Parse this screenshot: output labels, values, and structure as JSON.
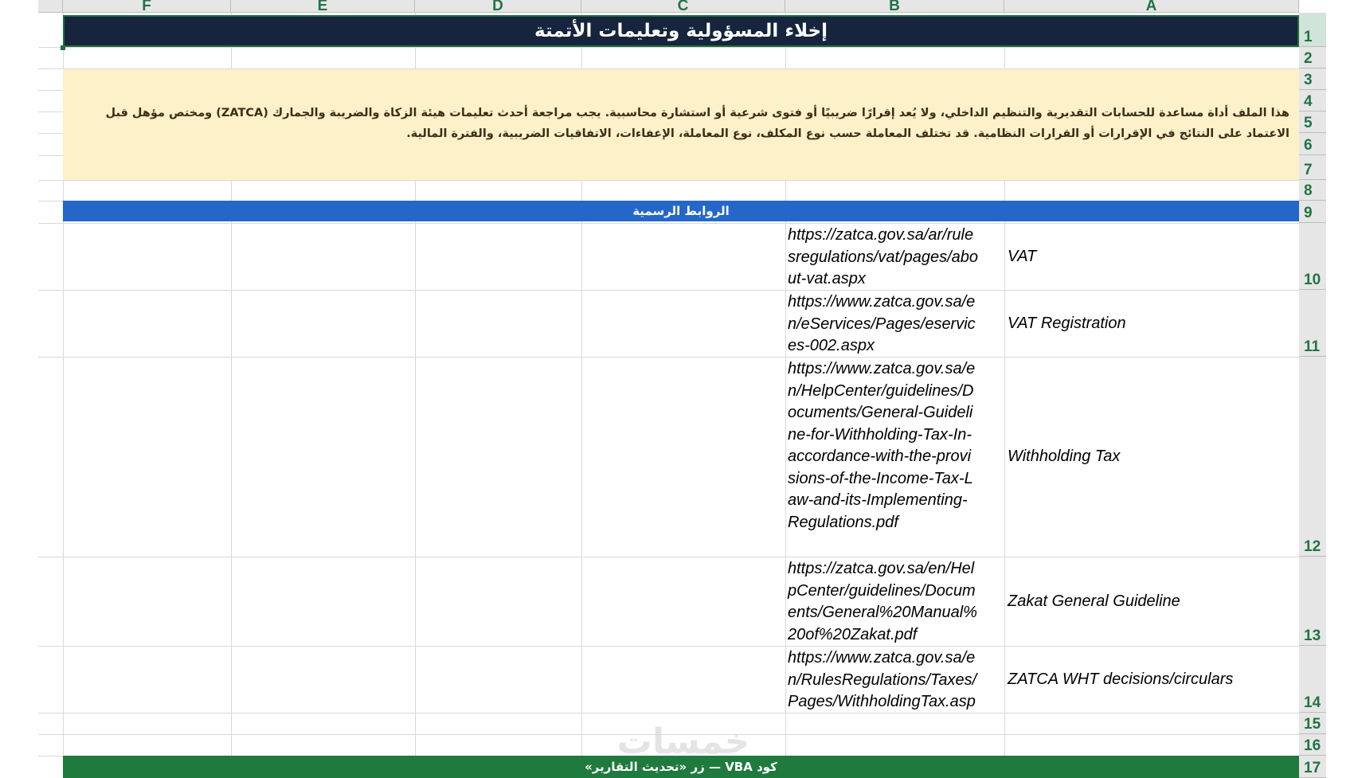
{
  "columns": [
    "F",
    "E",
    "D",
    "C",
    "B",
    "A"
  ],
  "rows": [
    "1",
    "2",
    "3",
    "4",
    "5",
    "6",
    "7",
    "8",
    "9",
    "10",
    "11",
    "12",
    "13",
    "14",
    "15",
    "16",
    "17"
  ],
  "title": "إخلاء المسؤولية وتعليمات الأتمتة",
  "disclaimer": "هذا الملف أداة مساعدة للحسابات التقديرية والتنظيم الداخلي، ولا يُعد إقرارًا ضريبيًا أو فتوى شرعية أو استشارة محاسبية. يجب مراجعة أحدث تعليمات هيئة الزكاة والضريبة والجمارك (ZATCA) ومختص مؤهل قبل الاعتماد على النتائج في الإقرارات أو القرارات النظامية. قد تختلف المعاملة حسب نوع المكلف، نوع المعاملة، الإعفاءات، الاتفاقيات الضريبية، والفترة المالية.",
  "links_header": "الروابط الرسمية",
  "links": [
    {
      "url": "https://zatca.gov.sa/ar/rulesregulations/vat/pages/about-vat.aspx",
      "name": "VAT"
    },
    {
      "url": "https://www.zatca.gov.sa/en/eServices/Pages/eservices-002.aspx",
      "name": "VAT Registration"
    },
    {
      "url": "https://www.zatca.gov.sa/en/HelpCenter/guidelines/Documents/General-Guideline-for-Withholding-Tax-In-accordance-with-the-provisions-of-the-Income-Tax-Law-and-its-Implementing-Regulations.pdf",
      "name": "Withholding Tax"
    },
    {
      "url": "https://zatca.gov.sa/en/HelpCenter/guidelines/Documents/General%20Manual%20of%20Zakat.pdf",
      "name": "Zakat General Guideline"
    },
    {
      "url": "https://www.zatca.gov.sa/en/RulesRegulations/Taxes/Pages/WithholdingTax.aspx",
      "name": "ZATCA WHT decisions/circulars"
    }
  ],
  "vba_header": "كود VBA — زر «تحديث التقارير»",
  "watermark": "خمسات"
}
